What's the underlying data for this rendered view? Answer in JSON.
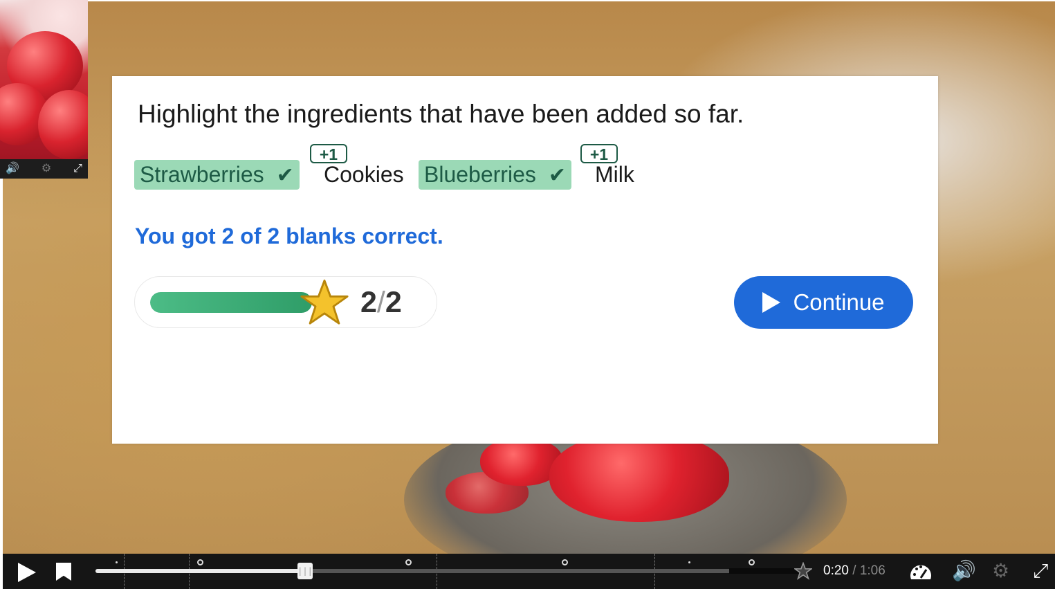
{
  "question": "Highlight the ingredients that have been added so far.",
  "answers": [
    {
      "text": "Strawberries",
      "highlighted": true,
      "correct": true,
      "check": "✔"
    },
    {
      "text": "Cookies",
      "highlighted": false,
      "badge": "+1"
    },
    {
      "text": "Blueberries",
      "highlighted": true,
      "correct": true,
      "check": "✔"
    },
    {
      "text": "Milk",
      "highlighted": false,
      "badge": "+1"
    }
  ],
  "feedback": "You got 2 of 2 blanks correct.",
  "score": {
    "current": "2",
    "separator": "/",
    "max": "2",
    "fill_fraction": 1.0
  },
  "continue_label": "Continue",
  "player": {
    "current_time": "0:20",
    "separator": " / ",
    "total_time": "1:06",
    "progress_fraction": 0.29
  },
  "colors": {
    "highlight": "#9bd9b6",
    "highlight_text": "#1d5a45",
    "feedback": "#1f6ad9",
    "button": "#1f6ad9",
    "progress_fill": "#3fae7a",
    "star": "#f4c22c"
  },
  "icons": {
    "mini_volume": "🔊",
    "mini_settings": "⚙",
    "mini_fullscreen": "⤢",
    "speed": "speed-gauge-icon",
    "volume": "🔊",
    "settings": "⚙",
    "fullscreen": "⤢"
  }
}
